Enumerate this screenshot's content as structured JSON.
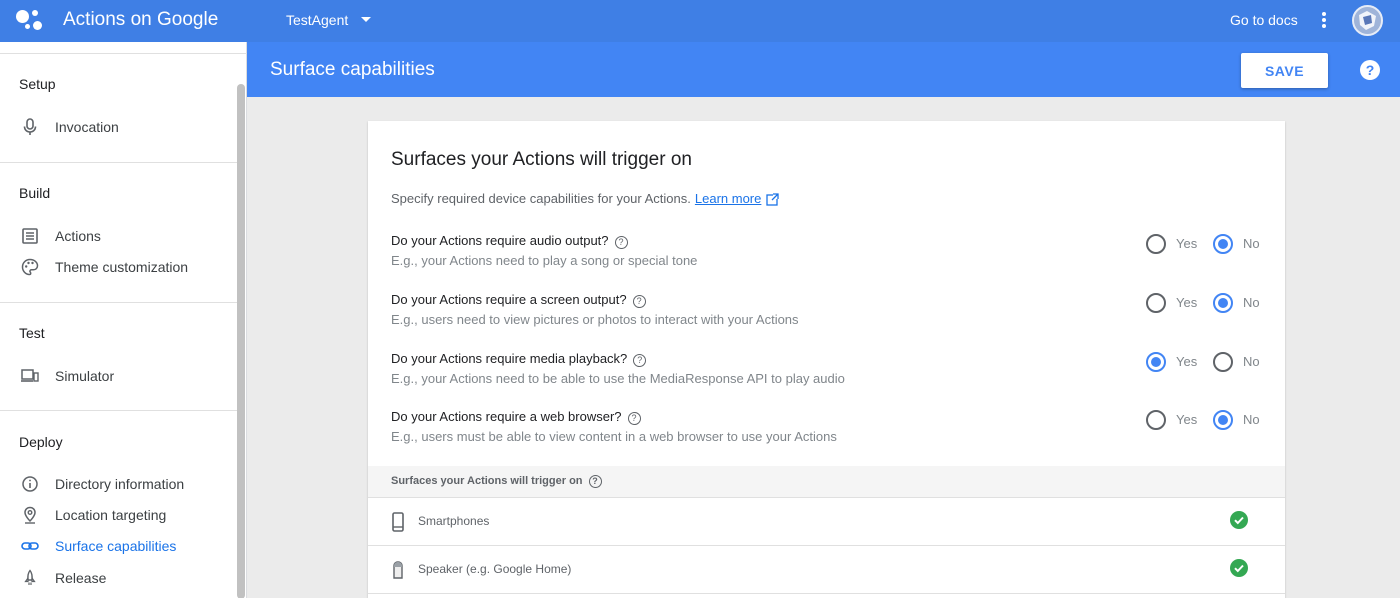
{
  "header": {
    "app_title": "Actions on Google",
    "project_name": "TestAgent",
    "go_to_docs": "Go to docs"
  },
  "subheader": {
    "page_title": "Surface capabilities",
    "save_label": "SAVE",
    "help_glyph": "?"
  },
  "sidebar": {
    "sections": {
      "setup": "Setup",
      "build": "Build",
      "test": "Test",
      "deploy": "Deploy"
    },
    "items": {
      "invocation": "Invocation",
      "actions": "Actions",
      "theme": "Theme customization",
      "simulator": "Simulator",
      "directory": "Directory information",
      "location": "Location targeting",
      "surface": "Surface capabilities",
      "release": "Release"
    },
    "active_item": "surface"
  },
  "card": {
    "title": "Surfaces your Actions will trigger on",
    "description": "Specify required device capabilities for your Actions.",
    "learn_more": "Learn more",
    "questions": [
      {
        "question": "Do your Actions require audio output?",
        "example": "E.g., your Actions need to play a song or special tone",
        "yes_label": "Yes",
        "no_label": "No",
        "selected": "no"
      },
      {
        "question": "Do your Actions require a screen output?",
        "example": "E.g., users need to view pictures or photos to interact with your Actions",
        "yes_label": "Yes",
        "no_label": "No",
        "selected": "no"
      },
      {
        "question": "Do your Actions require media playback?",
        "example": "E.g., your Actions need to be able to use the MediaResponse API to play audio",
        "yes_label": "Yes",
        "no_label": "No",
        "selected": "yes"
      },
      {
        "question": "Do your Actions require a web browser?",
        "example": "E.g., users must be able to view content in a web browser to use your Actions",
        "yes_label": "Yes",
        "no_label": "No",
        "selected": "no"
      }
    ],
    "surfaces_header": "Surfaces your Actions will trigger on",
    "surfaces": [
      {
        "name": "Smartphones",
        "icon": "smartphone-icon",
        "enabled": true
      },
      {
        "name": "Speaker (e.g. Google Home)",
        "icon": "speaker-icon",
        "enabled": true
      }
    ]
  },
  "colors": {
    "topbar": "#3f7fe5",
    "subbar": "#4285f4",
    "accent": "#4285f4",
    "link": "#1a73e8",
    "check": "#34a853"
  }
}
